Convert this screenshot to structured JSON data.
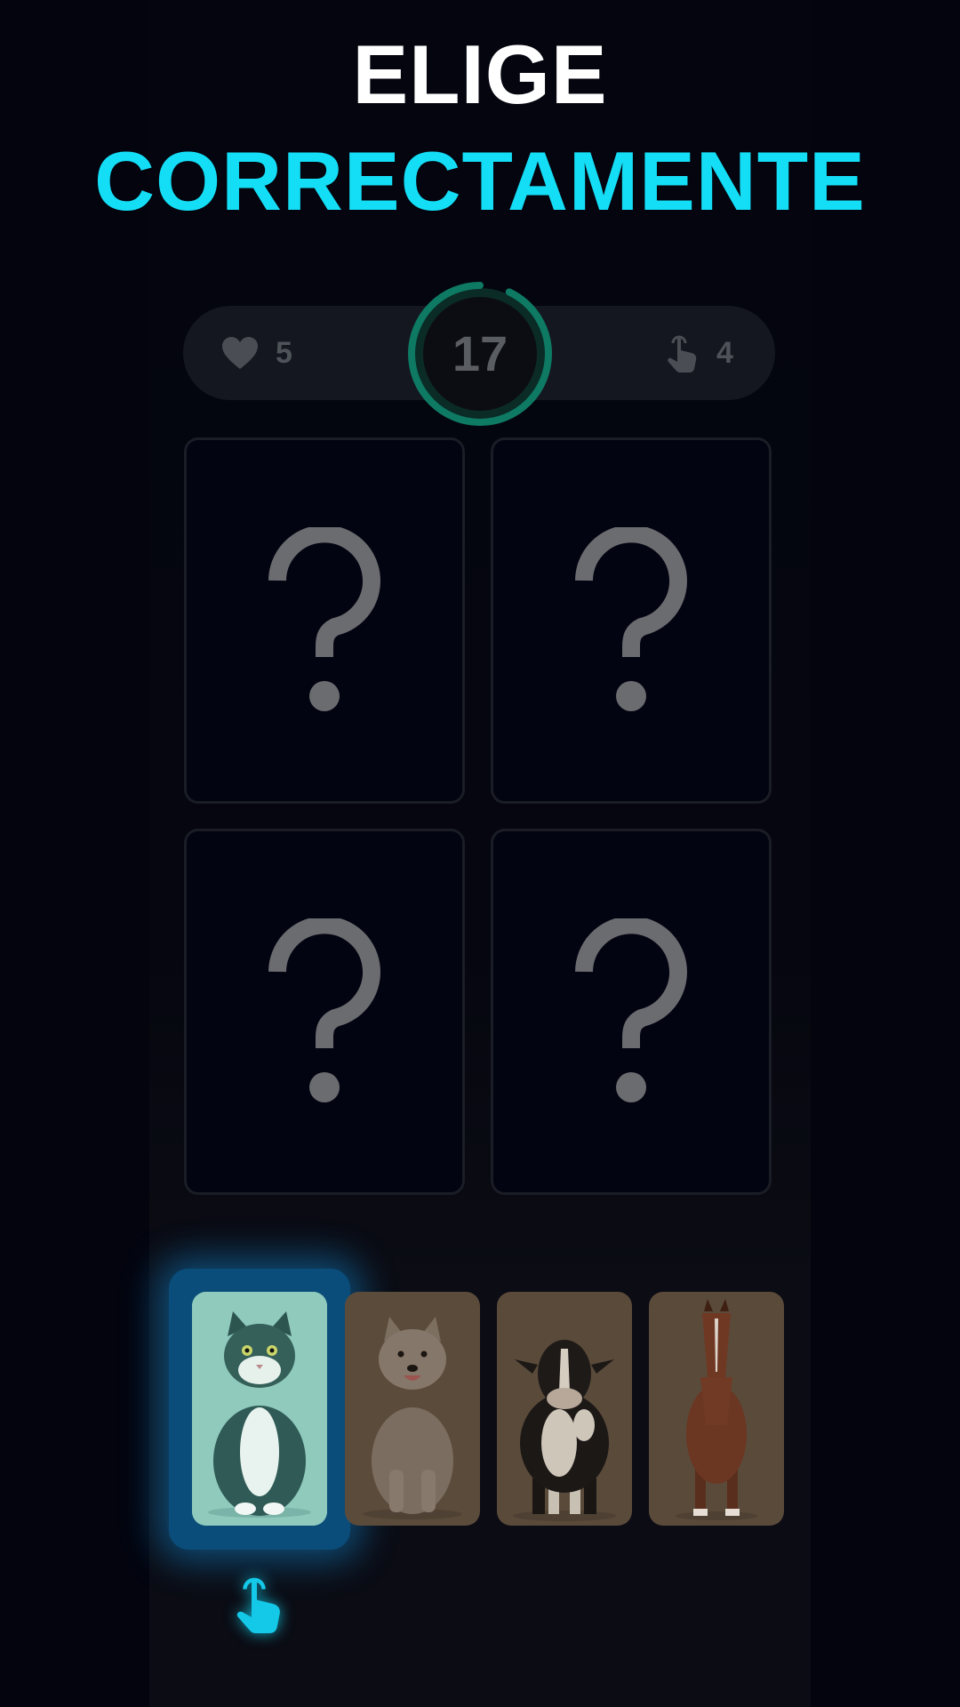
{
  "title": {
    "line1": "ELIGE",
    "line2": "CORRECTAMENTE"
  },
  "hud": {
    "lives": "5",
    "timer": "17",
    "timer_progress": 0.93,
    "taps": "4"
  },
  "colors": {
    "accent": "#14def6",
    "timer_ring": "#0e7a63",
    "card_border": "#1a1d25",
    "question_mark": "#6b6c70"
  },
  "cards": [
    {
      "icon": "question-mark-icon",
      "symbol": "?"
    },
    {
      "icon": "question-mark-icon",
      "symbol": "?"
    },
    {
      "icon": "question-mark-icon",
      "symbol": "?"
    },
    {
      "icon": "question-mark-icon",
      "symbol": "?"
    }
  ],
  "options": [
    {
      "animal": "cat",
      "selected": true
    },
    {
      "animal": "dog",
      "selected": false
    },
    {
      "animal": "cow",
      "selected": false
    },
    {
      "animal": "horse",
      "selected": false
    }
  ]
}
